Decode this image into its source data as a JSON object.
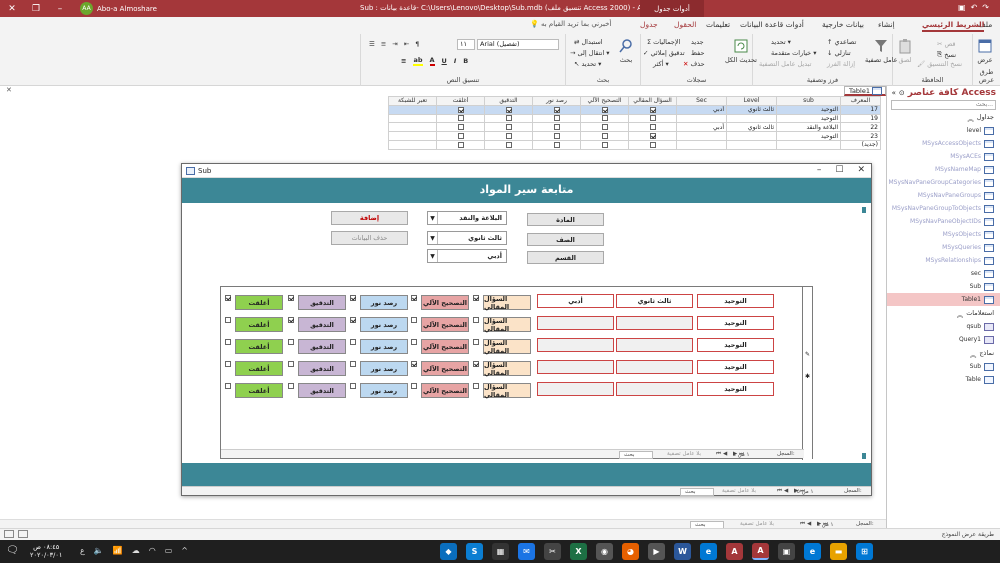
{
  "titlebar": {
    "title": "Sub : قاعدة بيانات- C:\\Users\\Lenovo\\Desktop\\Sub.mdb (تنسيق ملف Access 2000) - Access",
    "contextual_tab": "أدوات جدول",
    "user_name": "Abo-a Almoshare",
    "user_initials": "AA"
  },
  "ribbon_tabs": {
    "file": "ملف",
    "home": "الشريط الرئيسي",
    "create": "إنشاء",
    "external": "بيانات خارجية",
    "dbtools": "أدوات قاعدة البيانات",
    "help": "تعليمات",
    "fields": "الحقول",
    "table": "جدول",
    "tell_me": "أخبرني بما تريد القيام به"
  },
  "ribbon": {
    "views": {
      "view": "عرض",
      "label": "طرق عرض"
    },
    "clipboard": {
      "cut": "قص",
      "copy": "نسخ",
      "format_painter": "نسخ التنسيق",
      "paste": "لصق",
      "label": "الحافظة"
    },
    "sort_filter": {
      "filter": "عامل تصفية",
      "ascending": "تصاعدي",
      "descending": "تنازلي",
      "remove_sort": "إزالة الفرز",
      "selection": "تحديد",
      "advanced": "خيارات متقدمة",
      "toggle_filter": "تبديل عامل التصفية",
      "label": "فرز وتصفية"
    },
    "records": {
      "refresh_all": "تحديث الكل",
      "new": "جديد",
      "save": "حفظ",
      "delete": "حذف",
      "totals": "الإجماليات",
      "spelling": "تدقيق إملائي",
      "more": "أكثر",
      "label": "سجلات"
    },
    "find": {
      "find": "بحث",
      "replace": "استبدال",
      "goto": "انتقال إلى",
      "select": "تحديد",
      "label": "بحث"
    },
    "text_format": {
      "font": "Arial (تفصيل)",
      "size": "١١",
      "label": "تنسيق النص"
    }
  },
  "nav": {
    "title": "كافة عناصر Access",
    "search_placeholder": "بحث...",
    "section_tables": "جداول",
    "tables": [
      "level",
      "MSysAccessObjects",
      "MSysACEs",
      "MSysNameMap",
      "MSysNavPaneGroupCategories",
      "MSysNavPaneGroups",
      "MSysNavPaneGroupToObjects",
      "MSysNavPaneObjectIDs",
      "MSysObjects",
      "MSysQueries",
      "MSysRelationships",
      "sec",
      "Sub",
      "Table1"
    ],
    "section_queries": "استعلامات",
    "queries": [
      "qsub",
      "Query1"
    ],
    "section_forms": "نماذج",
    "forms": [
      "Sub",
      "Table"
    ]
  },
  "doc_tab": {
    "label": "Table1"
  },
  "table": {
    "headers": [
      "المعرف",
      "sub",
      "Level",
      "Sec",
      "السؤال المقالي",
      "التصحيح الآلي",
      "رصد نور",
      "التدقيق",
      "أغلقت",
      "تعبر للشبكة"
    ],
    "rows": [
      {
        "id": "17",
        "sub": "التوحيد",
        "level": "ثالث ثانوي",
        "sec": "أدبي",
        "c1": true,
        "c2": true,
        "c3": true,
        "c4": true,
        "c5": true
      },
      {
        "id": "19",
        "sub": "التوحيد",
        "level": "",
        "sec": "",
        "c1": false,
        "c2": false,
        "c3": false,
        "c4": false,
        "c5": false
      },
      {
        "id": "22",
        "sub": "البلاغة والنقد",
        "level": "ثالث ثانوي",
        "sec": "أدبي",
        "c1": false,
        "c2": false,
        "c3": false,
        "c4": false,
        "c5": false
      },
      {
        "id": "23",
        "sub": "التوحيد",
        "level": "",
        "sec": "",
        "c1": true,
        "c2": false,
        "c3": false,
        "c4": false,
        "c5": false
      },
      {
        "id": "(جديد)",
        "sub": "",
        "level": "",
        "sec": "",
        "c1": false,
        "c2": false,
        "c3": false,
        "c4": false,
        "c5": false
      }
    ]
  },
  "main_recnav": {
    "label": "السجل:",
    "position": "١ من ٤",
    "filter": "بلا عامل تصفية",
    "search": "بحث"
  },
  "form": {
    "window_title": "Sub",
    "header": "متابعة سير المواد",
    "labels": {
      "subject": "المادة",
      "grade": "الصف",
      "section": "القسم"
    },
    "combos": {
      "subject": "البلاغة والنقد",
      "grade": "ثالث ثانوي",
      "section": "أدبي"
    },
    "buttons": {
      "add": "إضافة",
      "delete": "حذف البيانات"
    },
    "subform_rows": [
      {
        "sub": "التوحيد",
        "level": "ثالث ثانوي",
        "sec": "أدبي",
        "c1": true,
        "c2": true,
        "c3": true,
        "c4": true,
        "c5": true
      },
      {
        "sub": "التوحيد",
        "level": "",
        "sec": "",
        "c1": false,
        "c2": false,
        "c3": true,
        "c4": true,
        "c5": false
      },
      {
        "sub": "التوحيد",
        "level": "",
        "sec": "",
        "c1": false,
        "c2": false,
        "c3": false,
        "c4": false,
        "c5": false
      },
      {
        "sub": "التوحيد",
        "level": "",
        "sec": "",
        "c1": true,
        "c2": true,
        "c3": false,
        "c4": false,
        "c5": false
      },
      {
        "sub": "التوحيد",
        "level": "",
        "sec": "",
        "c1": false,
        "c2": false,
        "c3": false,
        "c4": false,
        "c5": false
      }
    ],
    "subform_buttons": {
      "essay": "السؤال المقالي",
      "autocorrect": "التصحيح الآلي",
      "noor": "رصد نور",
      "audit": "التدقيق",
      "closed": "أغلقت"
    },
    "subnav": {
      "label": "السجل:",
      "position": "١ من ٤",
      "filter": "بلا عامل تصفية",
      "search": "بحث"
    },
    "fnav": {
      "label": "السجل:",
      "position": "١ من ٣٥",
      "filter": "بلا عامل تصفية",
      "search": "بحث"
    }
  },
  "statusbar": {
    "text": "طريقة عرض النموذج"
  },
  "taskbar": {
    "time": "٠٨:٤٥ ص",
    "date": "٢٠٢٠/٠٣/٠١"
  }
}
